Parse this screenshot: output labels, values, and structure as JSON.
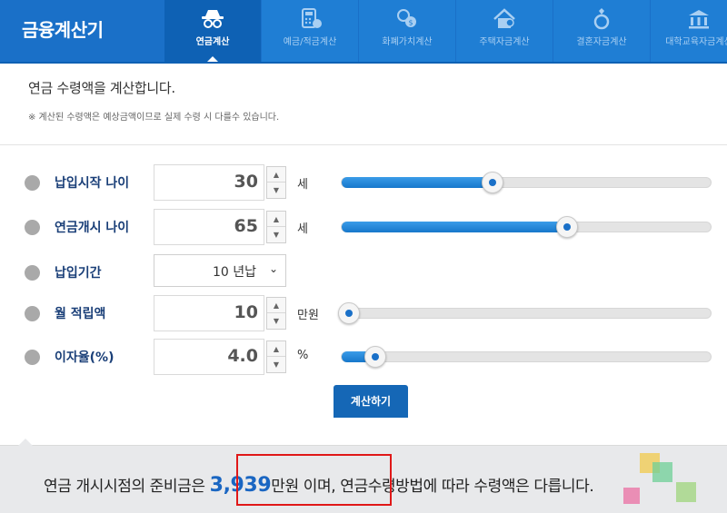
{
  "header": {
    "brand": "금융계산기",
    "tabs": [
      {
        "label": "연금계산",
        "icon": "spy-glasses-icon",
        "active": true
      },
      {
        "label": "예금/적금계산",
        "icon": "calculator-icon",
        "active": false
      },
      {
        "label": "화폐가치계산",
        "icon": "coins-icon",
        "active": false
      },
      {
        "label": "주택자금계산",
        "icon": "house-icon",
        "active": false
      },
      {
        "label": "결혼자금계산",
        "icon": "ring-icon",
        "active": false
      },
      {
        "label": "대학교육자금계산",
        "icon": "university-icon",
        "active": false
      }
    ]
  },
  "description": {
    "title": "연금 수령액을 계산합니다.",
    "note": "※ 계산된 수령액은 예상금액이므로 실제 수령 시 다를수 있습니다."
  },
  "form": {
    "start_age": {
      "label": "납입시작 나이",
      "value": "30",
      "unit": "세",
      "slider_fraction": 0.41
    },
    "pension_age": {
      "label": "연금개시 나이",
      "value": "65",
      "unit": "세",
      "slider_fraction": 0.61
    },
    "period": {
      "label": "납입기간",
      "value": "10 년납"
    },
    "monthly": {
      "label": "월 적립액",
      "value": "10",
      "unit": "만원",
      "slider_fraction": 0.02
    },
    "rate": {
      "label": "이자율(%)",
      "value": "4.0",
      "unit": "%",
      "slider_fraction": 0.09
    },
    "submit_label": "계산하기"
  },
  "result": {
    "prefix": "연금 개시시점의 준비금은 ",
    "amount": "3,939",
    "amount_suffix": "만원 이며,",
    "suffix": " 연금수령방법에 따라 수령액은 다릅니다."
  },
  "colors": {
    "header_bg": "#1a70c8",
    "active_tab": "#0e61b4",
    "accent": "#1a66c2",
    "highlight": "#e01818"
  }
}
